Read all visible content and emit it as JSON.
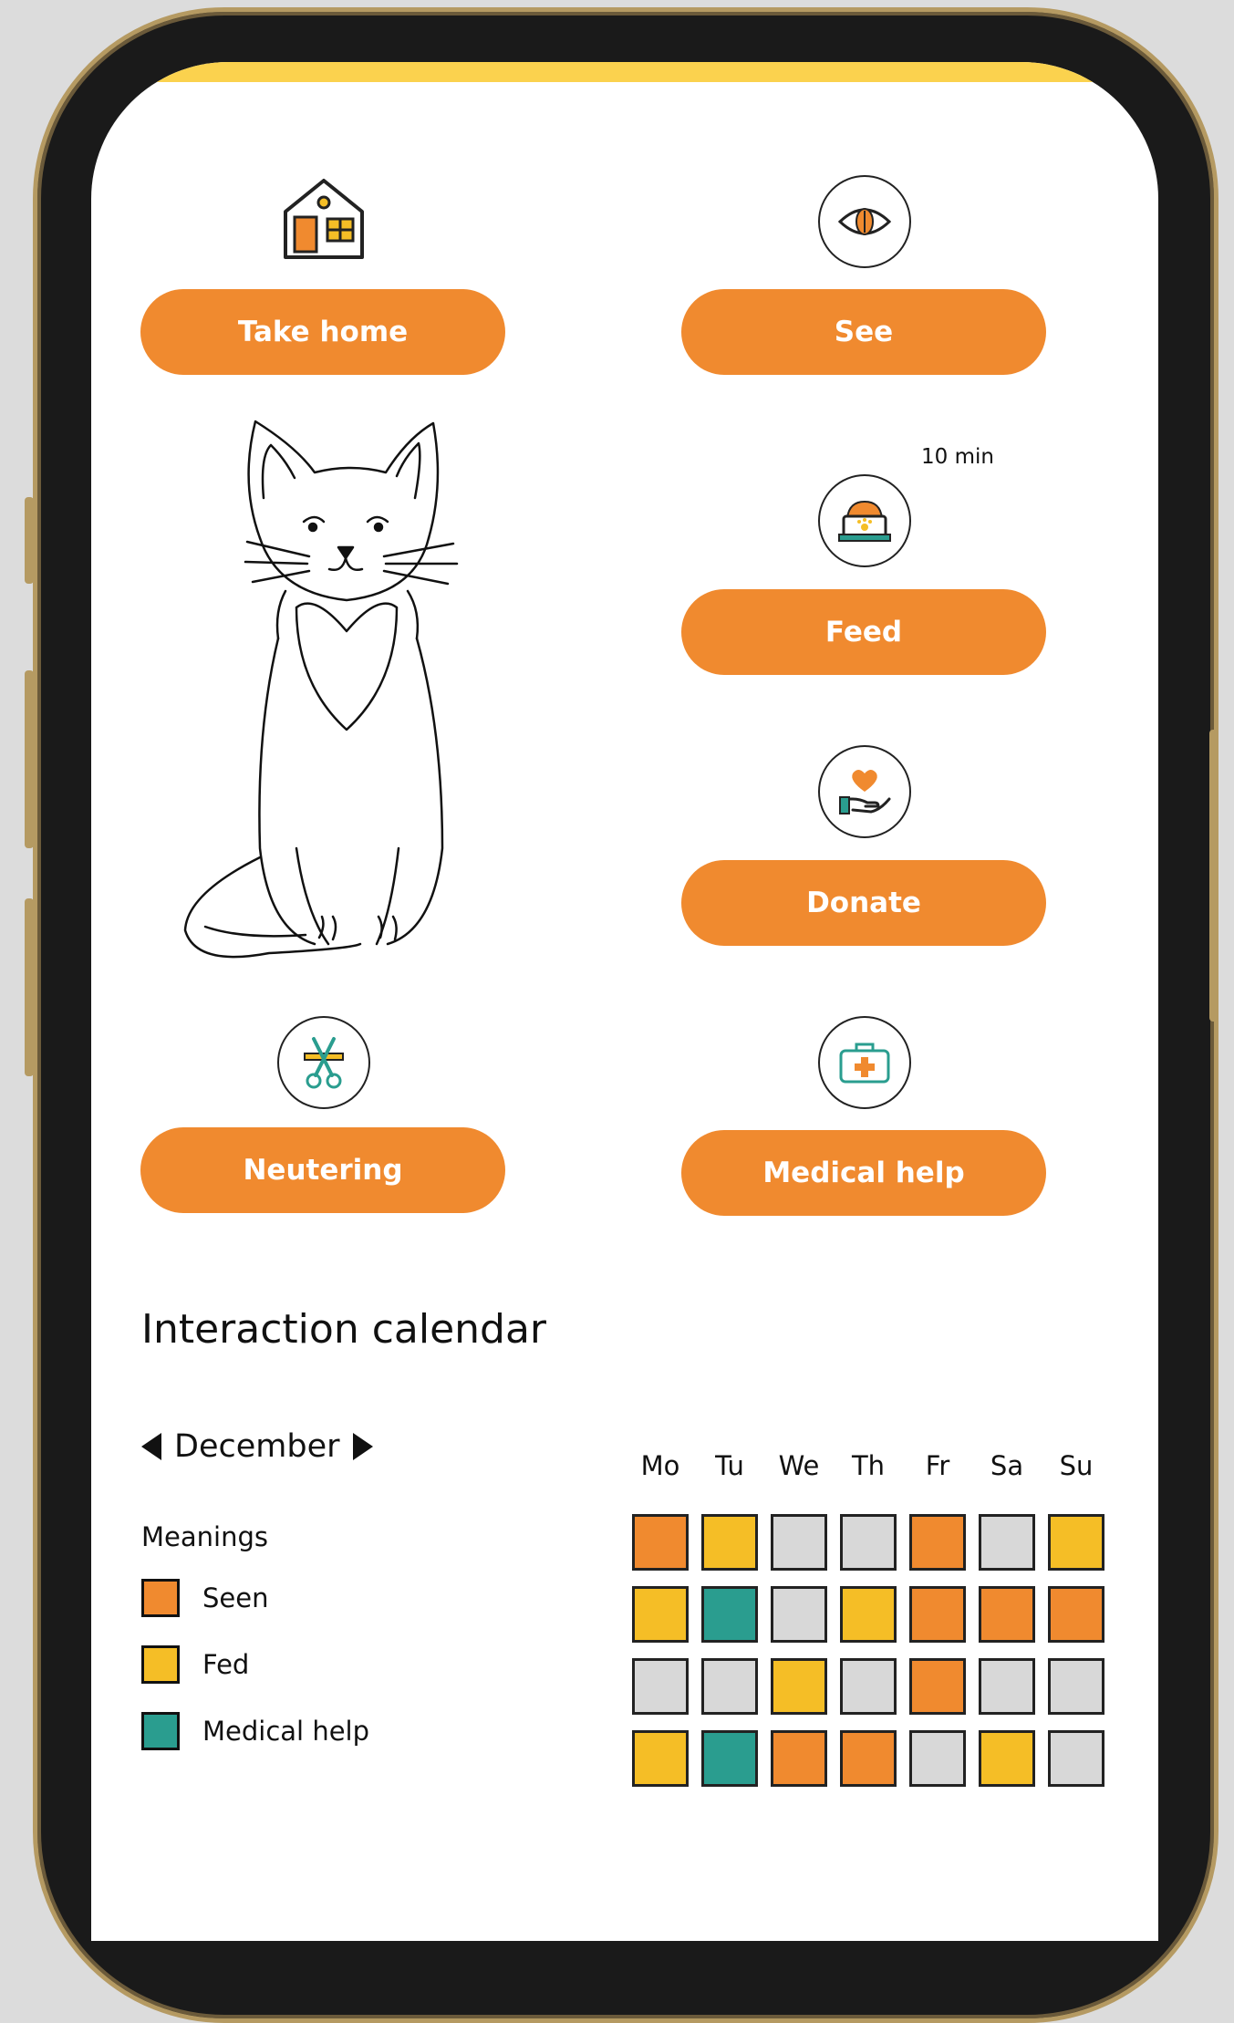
{
  "colors": {
    "accent": "#f08a2f",
    "seen": "#f08a2f",
    "fed": "#f5be26",
    "medical": "#2a9d8f",
    "none": "#d8d8d8"
  },
  "actions": {
    "take_home": {
      "label": "Take home",
      "icon": "house-icon"
    },
    "see": {
      "label": "See",
      "icon": "eye-icon"
    },
    "feed": {
      "label": "Feed",
      "icon": "food-bowl-icon",
      "timer": "10 min"
    },
    "donate": {
      "label": "Donate",
      "icon": "heart-hand-icon"
    },
    "neutering": {
      "label": "Neutering",
      "icon": "scissors-icon"
    },
    "medical_help": {
      "label": "Medical help",
      "icon": "first-aid-kit-icon"
    }
  },
  "calendar": {
    "title": "Interaction calendar",
    "month": "December",
    "meanings_title": "Meanings",
    "legend": [
      {
        "label": "Seen",
        "color": "#f08a2f"
      },
      {
        "label": "Fed",
        "color": "#f5be26"
      },
      {
        "label": "Medical help",
        "color": "#2a9d8f"
      }
    ],
    "days": [
      "Mo",
      "Tu",
      "We",
      "Th",
      "Fr",
      "Sa",
      "Su"
    ],
    "grid": [
      [
        "seen",
        "fed",
        "none",
        "none",
        "seen",
        "none",
        "fed"
      ],
      [
        "fed",
        "medical",
        "none",
        "fed",
        "seen",
        "seen",
        "seen"
      ],
      [
        "none",
        "none",
        "fed",
        "none",
        "seen",
        "none",
        "none"
      ],
      [
        "fed",
        "medical",
        "seen",
        "seen",
        "none",
        "fed",
        "none"
      ]
    ]
  }
}
